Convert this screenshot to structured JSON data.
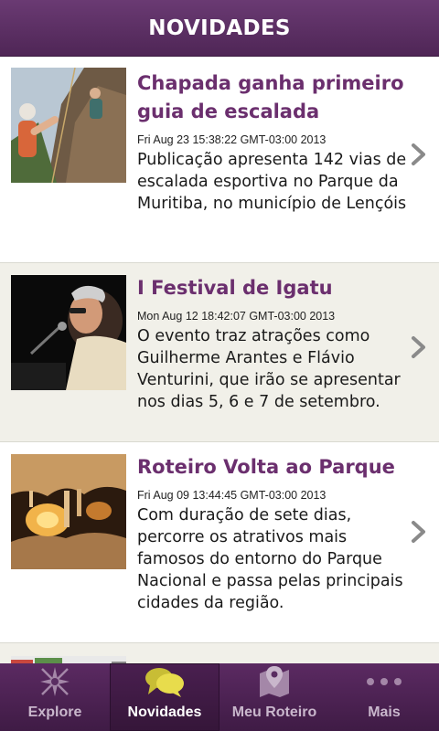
{
  "header": {
    "title": "NOVIDADES"
  },
  "news": [
    {
      "title": "Chapada ganha primeiro guia de escalada",
      "date": "Fri Aug 23 15:38:22 GMT-03:00 2013",
      "description": "Publicação apresenta 142 vias de escalada esportiva no Parque da Muritiba, no município de Lençóis",
      "image_icon": "climbing-photo"
    },
    {
      "title": "I Festival de Igatu",
      "date": "Mon Aug 12 18:42:07 GMT-03:00 2013",
      "description": "O evento traz atrações como Guilherme Arantes e Flávio Venturini, que irão se apresentar nos dias 5, 6 e 7 de setembro.",
      "image_icon": "singer-photo"
    },
    {
      "title": "Roteiro Volta ao Parque",
      "date": "Fri Aug 09 13:44:45 GMT-03:00 2013",
      "description": "Com duração de sete dias, percorre os atrativos mais famosos do entorno do Parque Nacional e passa pelas principais cidades da região.",
      "image_icon": "cave-photo"
    }
  ],
  "tabs": [
    {
      "label": "Explore",
      "icon": "compass-icon",
      "active": false
    },
    {
      "label": "Novidades",
      "icon": "chat-bubbles-icon",
      "active": true
    },
    {
      "label": "Meu Roteiro",
      "icon": "map-pin-icon",
      "active": false
    },
    {
      "label": "Mais",
      "icon": "more-dots-icon",
      "active": false
    }
  ],
  "colors": {
    "header": "#5a2d62",
    "title_purple": "#6b2f6e",
    "active_icon": "#e5d94a"
  }
}
